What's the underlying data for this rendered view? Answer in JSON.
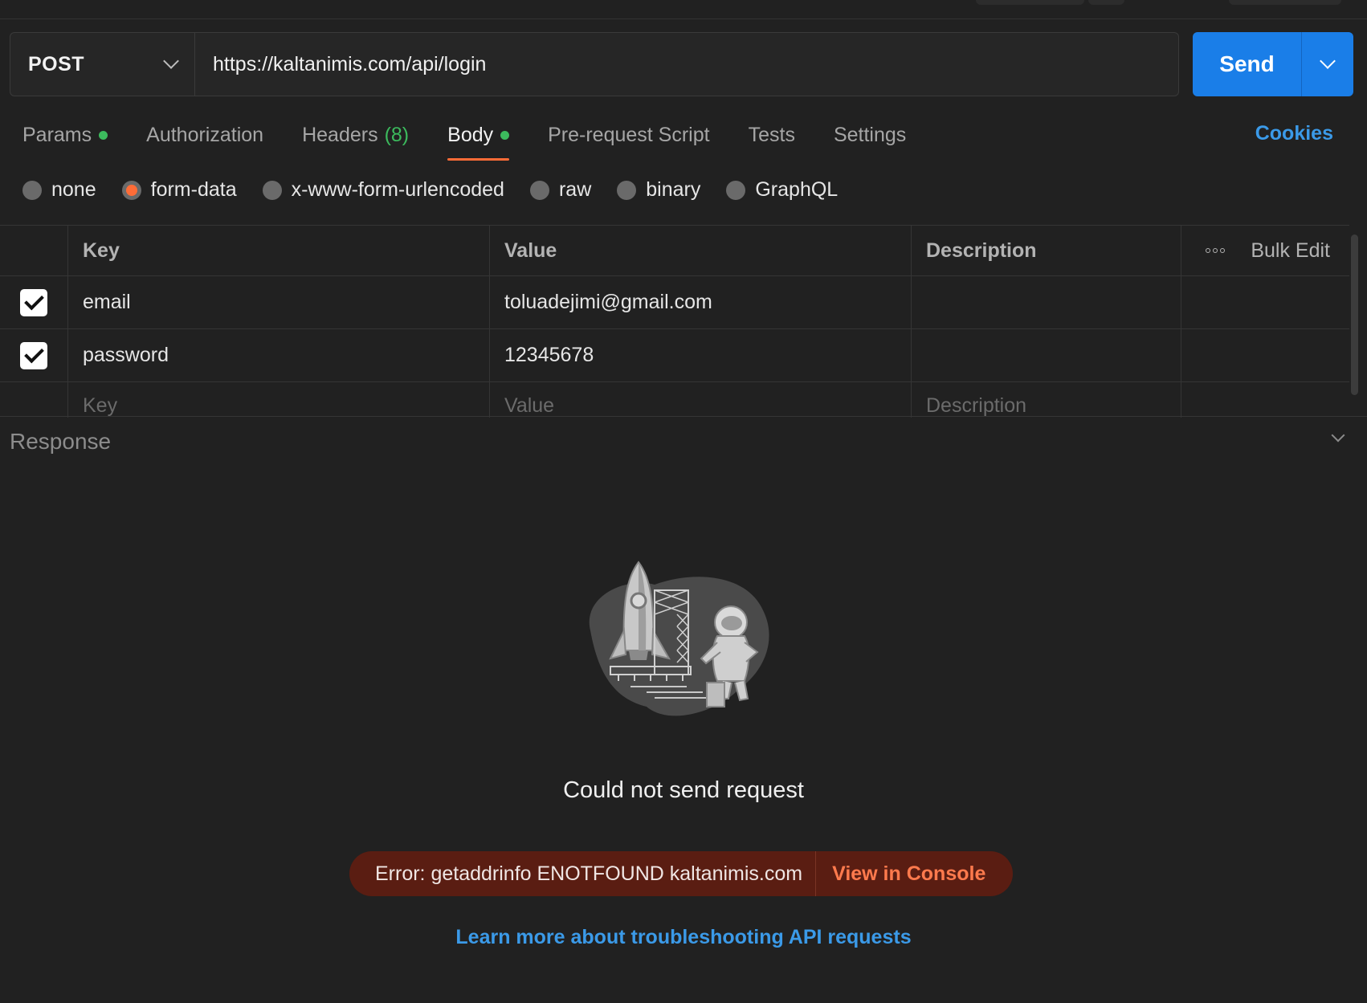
{
  "request": {
    "method": "POST",
    "url": "https://kaltanimis.com/api/login",
    "send_label": "Send"
  },
  "tabs": [
    {
      "label": "Params",
      "dot": true
    },
    {
      "label": "Authorization"
    },
    {
      "label": "Headers",
      "count": "(8)"
    },
    {
      "label": "Body",
      "dot": true,
      "active": true
    },
    {
      "label": "Pre-request Script"
    },
    {
      "label": "Tests"
    },
    {
      "label": "Settings"
    }
  ],
  "cookies_label": "Cookies",
  "body_types": [
    {
      "label": "none"
    },
    {
      "label": "form-data",
      "selected": true
    },
    {
      "label": "x-www-form-urlencoded"
    },
    {
      "label": "raw"
    },
    {
      "label": "binary"
    },
    {
      "label": "GraphQL"
    }
  ],
  "table": {
    "headers": {
      "key": "Key",
      "value": "Value",
      "description": "Description",
      "bulk_edit": "Bulk Edit"
    },
    "rows": [
      {
        "checked": true,
        "key": "email",
        "value": "toluadejimi@gmail.com",
        "description": ""
      },
      {
        "checked": true,
        "key": "password",
        "value": "12345678",
        "description": ""
      }
    ],
    "placeholders": {
      "key": "Key",
      "value": "Value",
      "description": "Description"
    }
  },
  "response": {
    "title": "Response",
    "message": "Could not send request",
    "error_text": "Error: getaddrinfo ENOTFOUND kaltanimis.com",
    "error_link": "View in Console",
    "learn_more": "Learn more about troubleshooting API requests"
  },
  "colors": {
    "accent": "#ff6c37",
    "send": "#1a7ee8",
    "link": "#3b9ae8",
    "status_dot": "#3cba5d",
    "error_bg": "#5a1d12"
  }
}
